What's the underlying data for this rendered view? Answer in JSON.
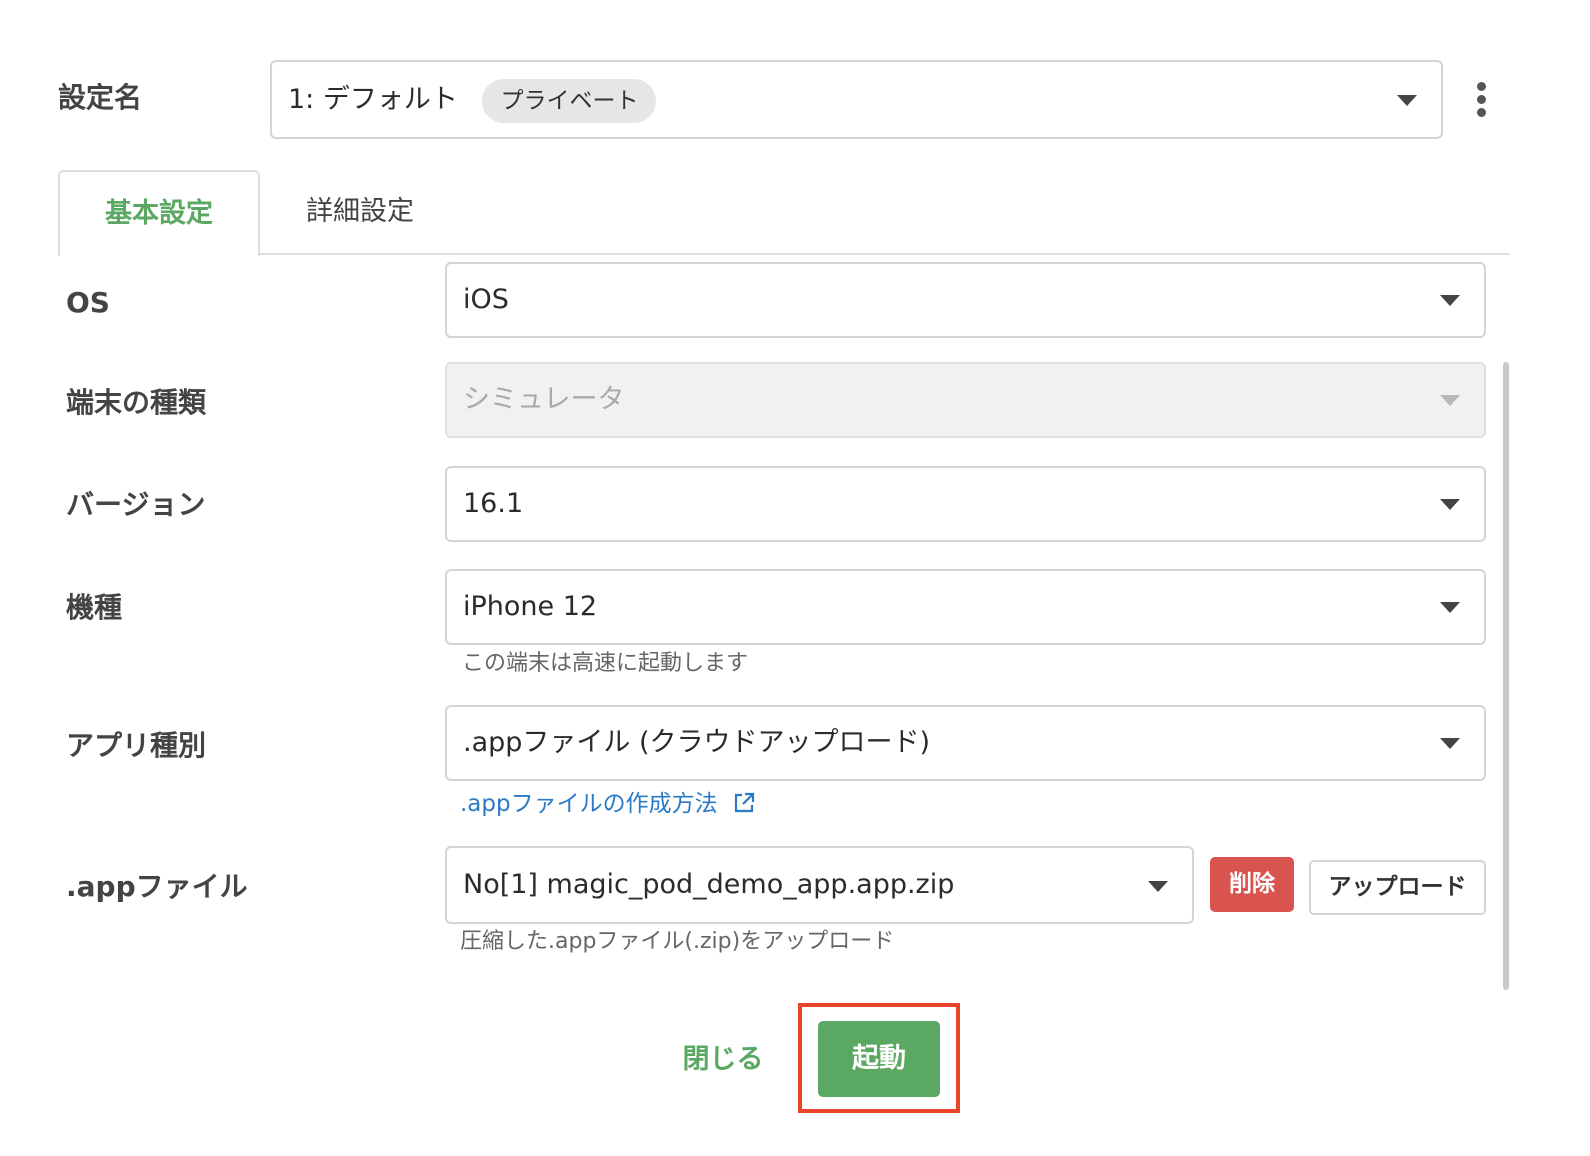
{
  "setting": {
    "label": "設定名",
    "value": "1: デフォルト",
    "badge": "プライベート"
  },
  "tabs": [
    {
      "label": "基本設定",
      "active": true
    },
    {
      "label": "詳細設定",
      "active": false
    }
  ],
  "form": {
    "os": {
      "label": "OS",
      "value": "iOS"
    },
    "device_type": {
      "label": "端末の種類",
      "value": "シミュレータ",
      "disabled": true
    },
    "version": {
      "label": "バージョン",
      "value": "16.1"
    },
    "model": {
      "label": "機種",
      "value": "iPhone 12",
      "hint": "この端末は高速に起動します"
    },
    "app_type": {
      "label": "アプリ種別",
      "value": ".appファイル (クラウドアップロード)",
      "link": ".appファイルの作成方法"
    },
    "app_file": {
      "label": ".appファイル",
      "value": "No[1] magic_pod_demo_app.app.zip",
      "hint": "圧縮した.appファイル(.zip)をアップロード",
      "delete_label": "削除",
      "upload_label": "アップロード"
    }
  },
  "footer": {
    "close_label": "閉じる",
    "start_label": "起動"
  },
  "colors": {
    "accent_green": "#5aa862",
    "danger_red": "#d9534f",
    "link_blue": "#2a7ac8",
    "highlight_red": "#e8452c"
  },
  "icons": {
    "more": "kebab-menu-icon",
    "external": "external-link-icon",
    "dropdown": "caret-down-icon"
  }
}
